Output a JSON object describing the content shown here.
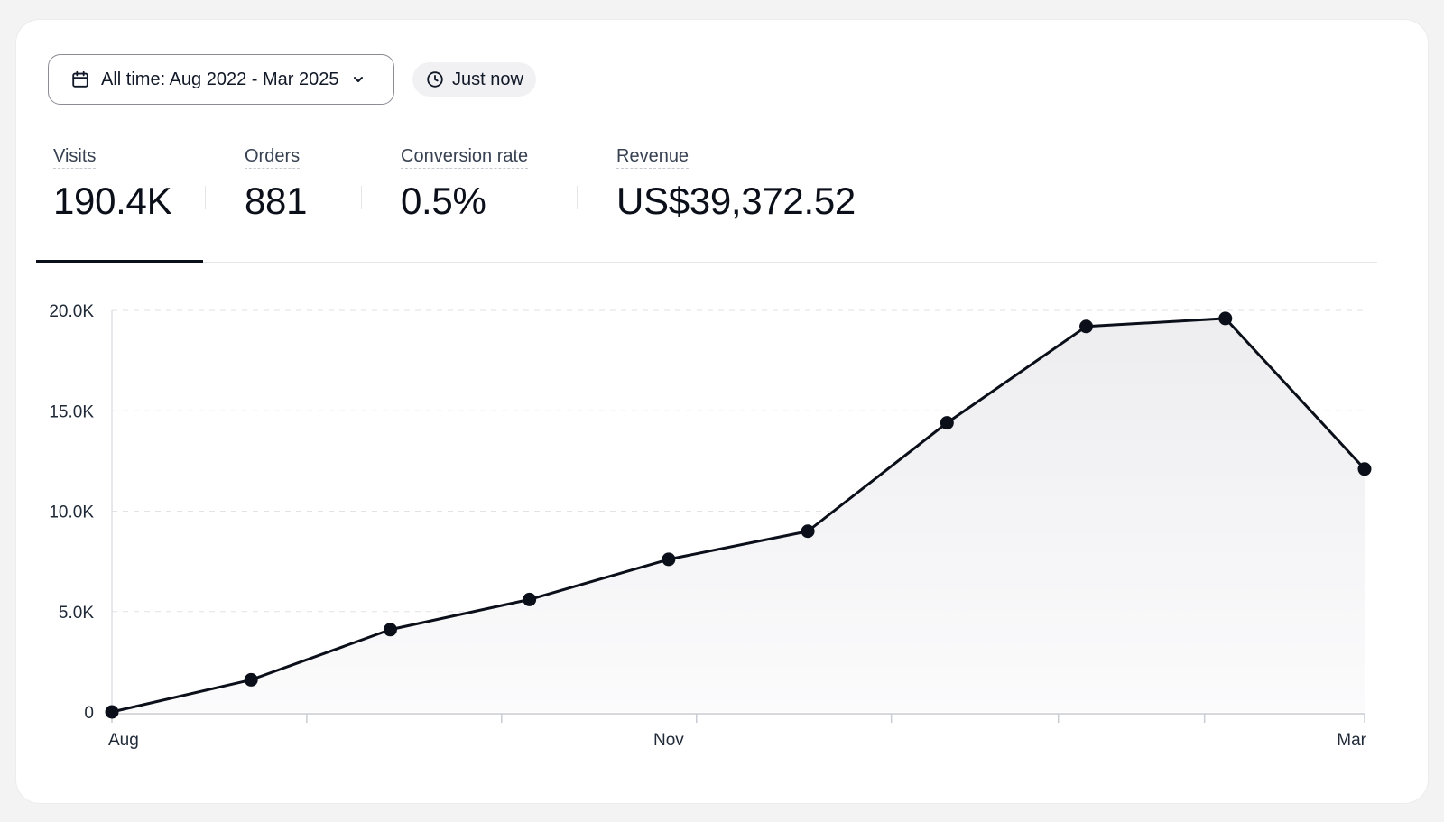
{
  "toolbar": {
    "date_range_label": "All time: Aug 2022 - Mar 2025",
    "date_icon": "calendar-icon",
    "dropdown_icon": "chevron-down-icon",
    "refresh_label": "Just now",
    "refresh_icon": "clock-icon"
  },
  "metrics": [
    {
      "label": "Visits",
      "value": "190.4K",
      "active": true
    },
    {
      "label": "Orders",
      "value": "881"
    },
    {
      "label": "Conversion rate",
      "value": "0.5%"
    },
    {
      "label": "Revenue",
      "value": "US$39,372.52"
    }
  ],
  "colors": {
    "line": "#0b0f19",
    "area": "#f3f3f5",
    "grid": "#e2e2e7",
    "axis": "#c9ccd3"
  },
  "chart_data": {
    "type": "area",
    "title": "",
    "xlabel": "",
    "ylabel": "",
    "x": [
      0,
      1,
      2,
      3,
      4,
      5,
      6,
      7,
      8,
      9
    ],
    "x_tick_labels": [
      {
        "x": 0,
        "label": "Aug"
      },
      {
        "x": 4,
        "label": "Nov"
      },
      {
        "x": 9,
        "label": "Mar"
      }
    ],
    "series": [
      {
        "values": [
          0,
          1600,
          4100,
          5600,
          7600,
          9000,
          14400,
          19200,
          19600,
          12100
        ]
      }
    ],
    "ylim": [
      0,
      20000
    ],
    "y_ticks": [
      0,
      5000,
      10000,
      15000,
      20000
    ],
    "y_tick_labels": [
      "0",
      "5.0K",
      "10.0K",
      "15.0K",
      "20.0K"
    ],
    "grid": true,
    "markers": true
  }
}
